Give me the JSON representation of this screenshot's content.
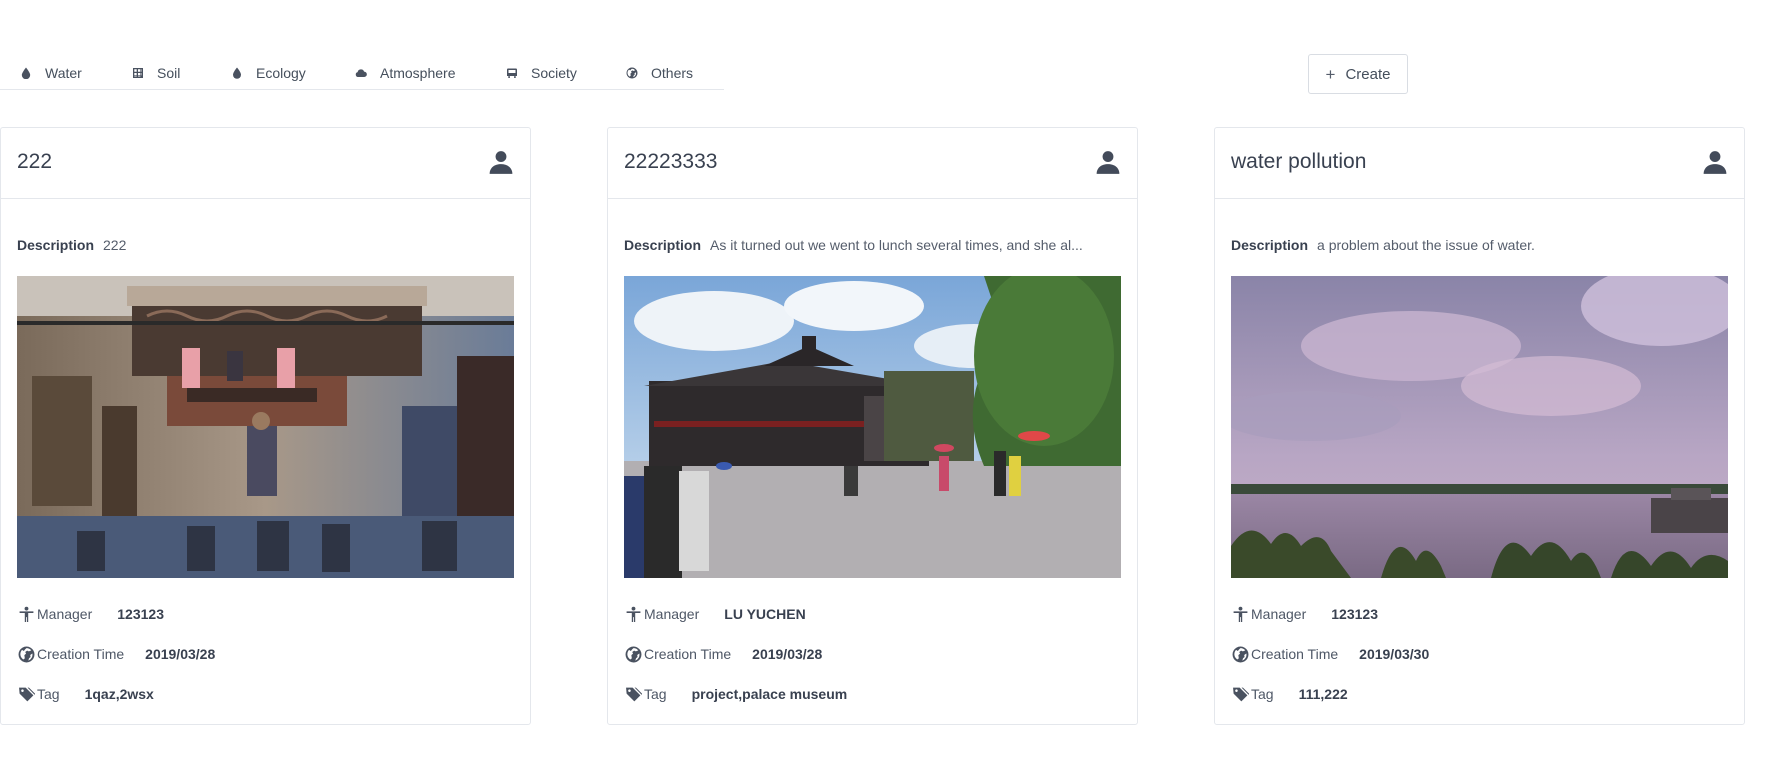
{
  "tabs": [
    {
      "label": "Water",
      "icon": "water-drop-icon"
    },
    {
      "label": "Soil",
      "icon": "grid-icon"
    },
    {
      "label": "Ecology",
      "icon": "leaf-drop-icon"
    },
    {
      "label": "Atmosphere",
      "icon": "cloud-icon"
    },
    {
      "label": "Society",
      "icon": "bus-icon"
    },
    {
      "label": "Others",
      "icon": "globe-icon"
    }
  ],
  "toolbar": {
    "create_label": "Create",
    "create_icon": "plus-icon"
  },
  "labels": {
    "description": "Description",
    "manager": "Manager",
    "creation_time": "Creation Time",
    "tag": "Tag"
  },
  "cards": [
    {
      "title": "222",
      "description": "222",
      "manager": "123123",
      "creation_time": "2019/03/28",
      "tag": "1qaz,2wsx",
      "photo": "museum-diorama"
    },
    {
      "title": "22223333",
      "description": "As it turned out we went to lunch several times, and she al...",
      "manager": "LU YUCHEN",
      "creation_time": "2019/03/28",
      "tag": "project,palace museum",
      "photo": "palace-plaza"
    },
    {
      "title": "water pollution",
      "description": "a problem about the issue of water.",
      "manager": "123123",
      "creation_time": "2019/03/30",
      "tag": "111,222",
      "photo": "river-sky"
    }
  ]
}
